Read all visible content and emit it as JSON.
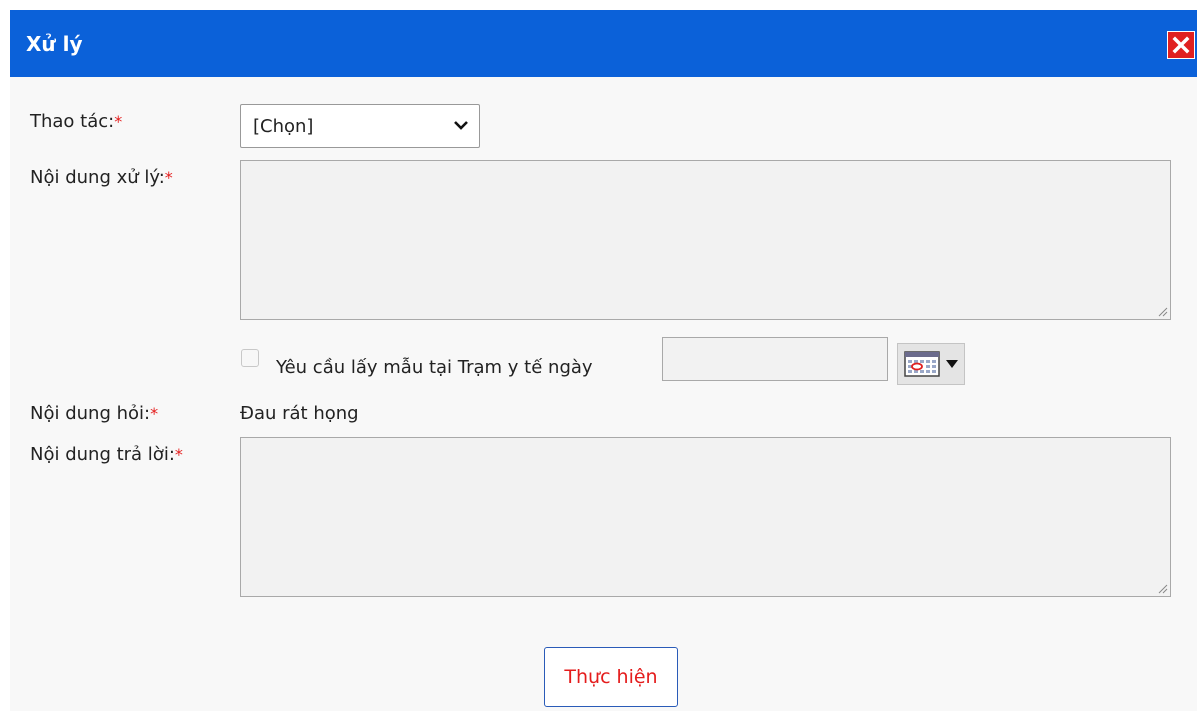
{
  "dialog": {
    "title": "Xử lý",
    "accent_color": "#0b61d9",
    "close_icon": "close-icon"
  },
  "form": {
    "operation": {
      "label": "Thao tác:",
      "required_mark": "*",
      "selected_value": "[Chọn]"
    },
    "process_content": {
      "label": "Nội dung xử lý:",
      "required_mark": "*",
      "value": ""
    },
    "sample_request": {
      "checkbox_checked": false,
      "label": "Yêu cầu lấy mẫu tại Trạm y tế ngày",
      "date_value": "",
      "calendar_icon": "calendar-icon"
    },
    "question": {
      "label": "Nội dung hỏi:",
      "required_mark": "*",
      "value": "Đau rát họng"
    },
    "answer": {
      "label": "Nội dung trả lời:",
      "required_mark": "*",
      "value": ""
    }
  },
  "actions": {
    "submit_label": "Thực hiện"
  }
}
